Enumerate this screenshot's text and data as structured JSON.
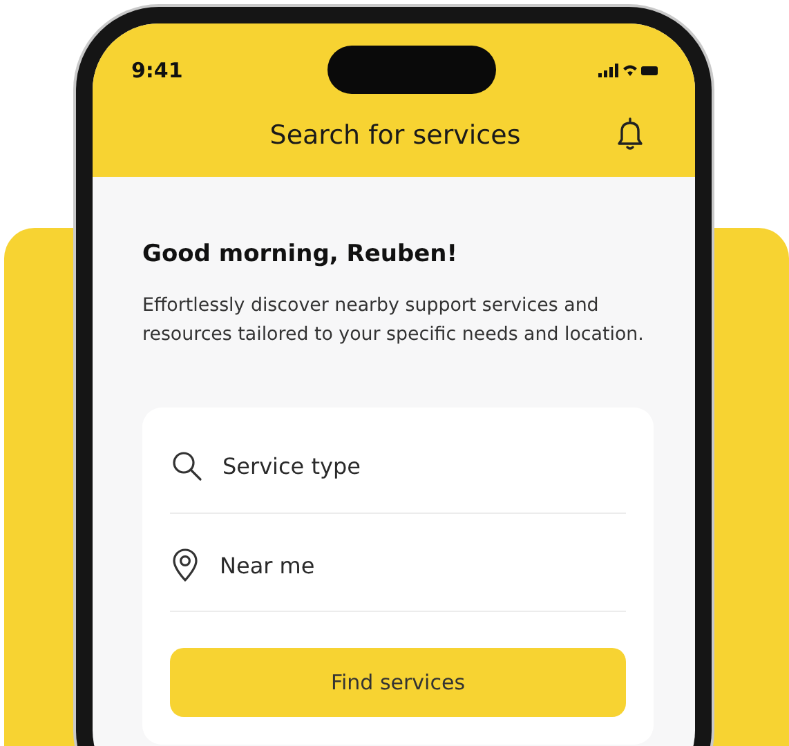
{
  "status_bar": {
    "time": "9:41"
  },
  "header": {
    "title": "Search for services"
  },
  "greeting": "Good morning, Reuben!",
  "description": "Effortlessly discover nearby support services and resources tailored to your specific needs and location.",
  "search_form": {
    "fields": [
      {
        "kind": "search",
        "placeholder": "Service type"
      },
      {
        "kind": "location",
        "placeholder": "Near me"
      }
    ],
    "button": "Find services"
  }
}
